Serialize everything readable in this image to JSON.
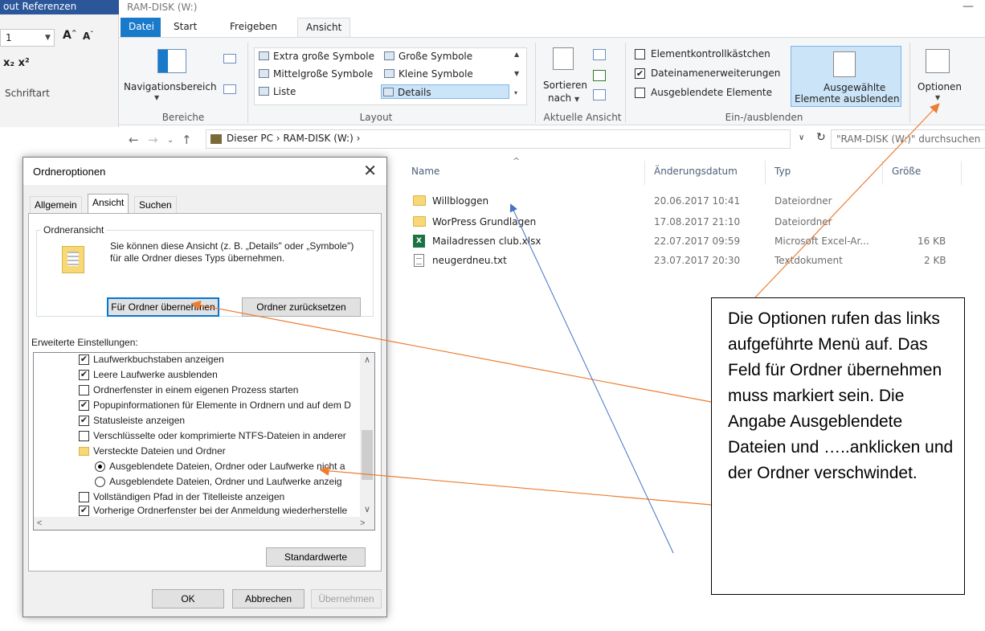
{
  "word": {
    "title_fragment": "out    Referenzen",
    "font_size": "1",
    "subscript_label": "x₂  x²",
    "group_label": "Schriftart"
  },
  "explorer": {
    "title": "RAM-DISK (W:)",
    "tabs": [
      "Datei",
      "Start",
      "Freigeben",
      "Ansicht"
    ],
    "ribbon": {
      "navigationsbereich": "Navigationsbereich",
      "group_bereiche": "Bereiche",
      "layout_items": [
        "Extra große Symbole",
        "Große Symbole",
        "Mittelgroße Symbole",
        "Kleine Symbole",
        "Liste",
        "Details"
      ],
      "group_layout": "Layout",
      "sortieren": "Sortieren",
      "nach": "nach",
      "group_aktuelle_ansicht": "Aktuelle Ansicht",
      "checkboxes": [
        {
          "label": "Elementkontrollkästchen",
          "checked": false
        },
        {
          "label": "Dateinamenerweiterungen",
          "checked": true
        },
        {
          "label": "Ausgeblendete Elemente",
          "checked": false
        }
      ],
      "ausgewaehlte_1": "Ausgewählte",
      "ausgewaehlte_2": "Elemente ausblenden",
      "group_einaus": "Ein-/ausblenden",
      "optionen": "Optionen"
    },
    "address": {
      "crumbs": "Dieser PC  ›  RAM-DISK (W:)  ›",
      "search_placeholder": "\"RAM-DISK (W:)\" durchsuchen"
    },
    "columns": {
      "name": "Name",
      "date": "Änderungsdatum",
      "type": "Typ",
      "size": "Größe"
    },
    "files": [
      {
        "name": "Willbloggen",
        "date": "20.06.2017 10:41",
        "type": "Dateiordner",
        "size": "",
        "icon": "folder-icon"
      },
      {
        "name": "WorPress Grundlagen",
        "date": "17.08.2017 21:10",
        "type": "Dateiordner",
        "size": "",
        "icon": "folder-icon"
      },
      {
        "name": "Mailadressen club.xlsx",
        "date": "22.07.2017 09:59",
        "type": "Microsoft Excel-Ar...",
        "size": "16 KB",
        "icon": "excel-icon"
      },
      {
        "name": "neugerdneu.txt",
        "date": "23.07.2017 20:30",
        "type": "Textdokument",
        "size": "2 KB",
        "icon": "text-file-icon"
      }
    ]
  },
  "dialog": {
    "title": "Ordneroptionen",
    "tabs": [
      "Allgemein",
      "Ansicht",
      "Suchen"
    ],
    "folder_view_legend": "Ordneransicht",
    "folder_view_text": "Sie können diese Ansicht (z. B. „Details\" oder „Symbole\") für alle Ordner dieses Typs übernehmen.",
    "btn_apply_folders": "Für Ordner übernehmen",
    "btn_reset_folders": "Ordner zurücksetzen",
    "advanced_label": "Erweiterte Einstellungen:",
    "tree": [
      {
        "kind": "check",
        "checked": true,
        "label": "Laufwerkbuchstaben anzeigen"
      },
      {
        "kind": "check",
        "checked": true,
        "label": "Leere Laufwerke ausblenden"
      },
      {
        "kind": "check",
        "checked": false,
        "label": "Ordnerfenster in einem eigenen Prozess starten"
      },
      {
        "kind": "check",
        "checked": true,
        "label": "Popupinformationen für Elemente in Ordnern und auf dem D"
      },
      {
        "kind": "check",
        "checked": true,
        "label": "Statusleiste anzeigen"
      },
      {
        "kind": "check",
        "checked": false,
        "label": "Verschlüsselte oder komprimierte NTFS-Dateien in anderer"
      },
      {
        "kind": "folder",
        "label": "Versteckte Dateien und Ordner"
      },
      {
        "kind": "radio",
        "checked": true,
        "label": "Ausgeblendete Dateien, Ordner oder Laufwerke nicht a"
      },
      {
        "kind": "radio",
        "checked": false,
        "label": "Ausgeblendete Dateien, Ordner und Laufwerke anzeig"
      },
      {
        "kind": "check",
        "checked": false,
        "label": "Vollständigen Pfad in der Titelleiste anzeigen"
      },
      {
        "kind": "check",
        "checked": true,
        "label": "Vorherige Ordnerfenster bei der Anmeldung wiederherstelle"
      }
    ],
    "btn_defaults": "Standardwerte",
    "btn_ok": "OK",
    "btn_cancel": "Abbrechen",
    "btn_apply": "Übernehmen"
  },
  "callout": {
    "text": "Die Optionen rufen das links aufgeführte Menü auf. Das Feld für Ordner übernehmen muss markiert sein. Die Angabe Ausgeblendete Dateien und …..anklicken und der Ordner verschwindet."
  },
  "colors": {
    "accent_blue": "#1979ca",
    "arrow_orange": "#ed7d31",
    "arrow_blue": "#4472c4",
    "selection": "#cce4f7"
  }
}
